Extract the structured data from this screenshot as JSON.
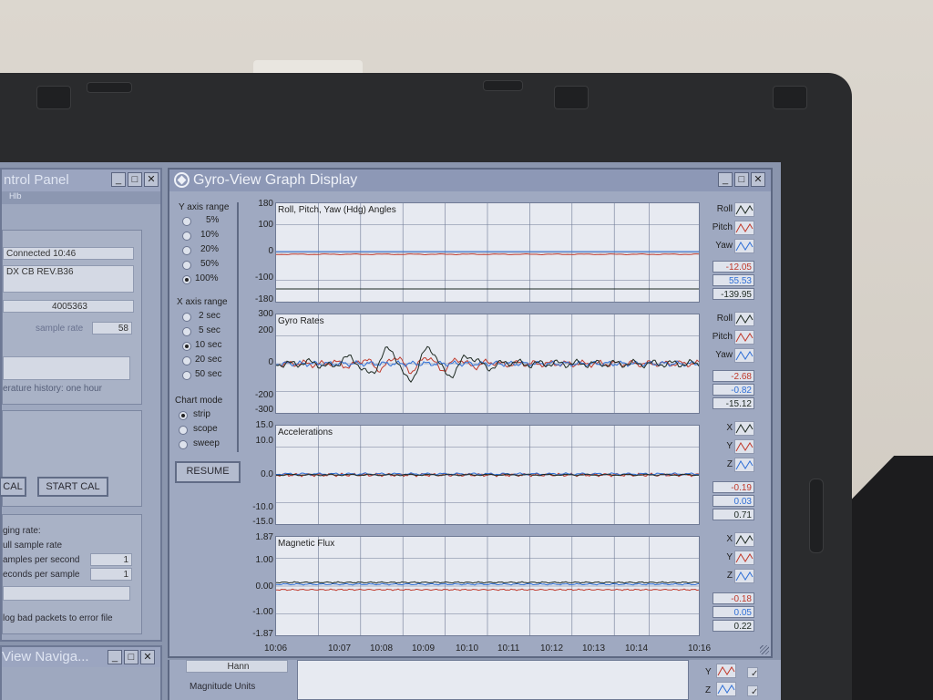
{
  "colors": {
    "roll": "#c0392b",
    "pitch": "#2f6fd6",
    "yaw": "#1e2a22"
  },
  "control_panel": {
    "title": "ntrol Panel",
    "subtitle": "Hlb",
    "status": "Connected 10:46",
    "device": "DX CB REV.B36",
    "serial": "4005363",
    "sample_rate_label": "sample rate",
    "sample_rate_value": "58",
    "history_label": "erature history: one hour",
    "cal_button": "CAL",
    "start_cal_button": "START CAL",
    "logging_rate_label": "ging rate:",
    "full_rate_label": "ull sample rate",
    "samples_per_second_label": "amples per second",
    "samples_per_second_value": "1",
    "seconds_per_sample_label": "econds per sample",
    "seconds_per_sample_value": "1",
    "log_bad_label": "log bad packets to error file"
  },
  "nav_window": {
    "title": "View Naviga..."
  },
  "gyro_view": {
    "title": "Gyro-View Graph Display",
    "y_range_label": "Y axis range",
    "y_range_options": [
      "5%",
      "10%",
      "20%",
      "50%",
      "100%"
    ],
    "y_range_selected": "100%",
    "x_range_label": "X axis range",
    "x_range_options": [
      "2 sec",
      "5 sec",
      "10 sec",
      "20 sec",
      "50 sec"
    ],
    "x_range_selected": "10 sec",
    "chart_mode_label": "Chart mode",
    "chart_mode_options": [
      "strip",
      "scope",
      "sweep"
    ],
    "chart_mode_selected": "strip",
    "resume_button": "RESUME",
    "x_ticks": [
      "10:06",
      "10:07",
      "10:08",
      "10:09",
      "10:10",
      "10:11",
      "10:12",
      "10:13",
      "10:14",
      "10:16"
    ],
    "panels": [
      {
        "title": "Roll, Pitch, Yaw (Hdg) Angles",
        "y_ticks": [
          "180",
          "100",
          "0",
          "-100",
          "-180"
        ],
        "legend": [
          "Roll",
          "Pitch",
          "Yaw"
        ],
        "values": [
          "-12.05",
          "55.53",
          "-139.95"
        ]
      },
      {
        "title": "Gyro Rates",
        "y_ticks": [
          "300",
          "200",
          "0",
          "-200",
          "-300"
        ],
        "legend": [
          "Roll",
          "Pitch",
          "Yaw"
        ],
        "values": [
          "-2.68",
          "-0.82",
          "-15.12"
        ]
      },
      {
        "title": "Accelerations",
        "y_ticks": [
          "15.0",
          "10.0",
          "0.0",
          "-10.0",
          "-15.0"
        ],
        "legend": [
          "X",
          "Y",
          "Z"
        ],
        "values": [
          "-0.19",
          "0.03",
          "0.71"
        ]
      },
      {
        "title": "Magnetic Flux",
        "y_ticks": [
          "1.87",
          "1.00",
          "0.00",
          "-1.00",
          "-1.87"
        ],
        "legend": [
          "X",
          "Y",
          "Z"
        ],
        "values": [
          "-0.18",
          "0.05",
          "0.22"
        ]
      }
    ]
  },
  "bottom_window": {
    "window_label": "Hann",
    "magnitude_label": "Magnitude Units",
    "legend": [
      "Y",
      "Z"
    ]
  }
}
